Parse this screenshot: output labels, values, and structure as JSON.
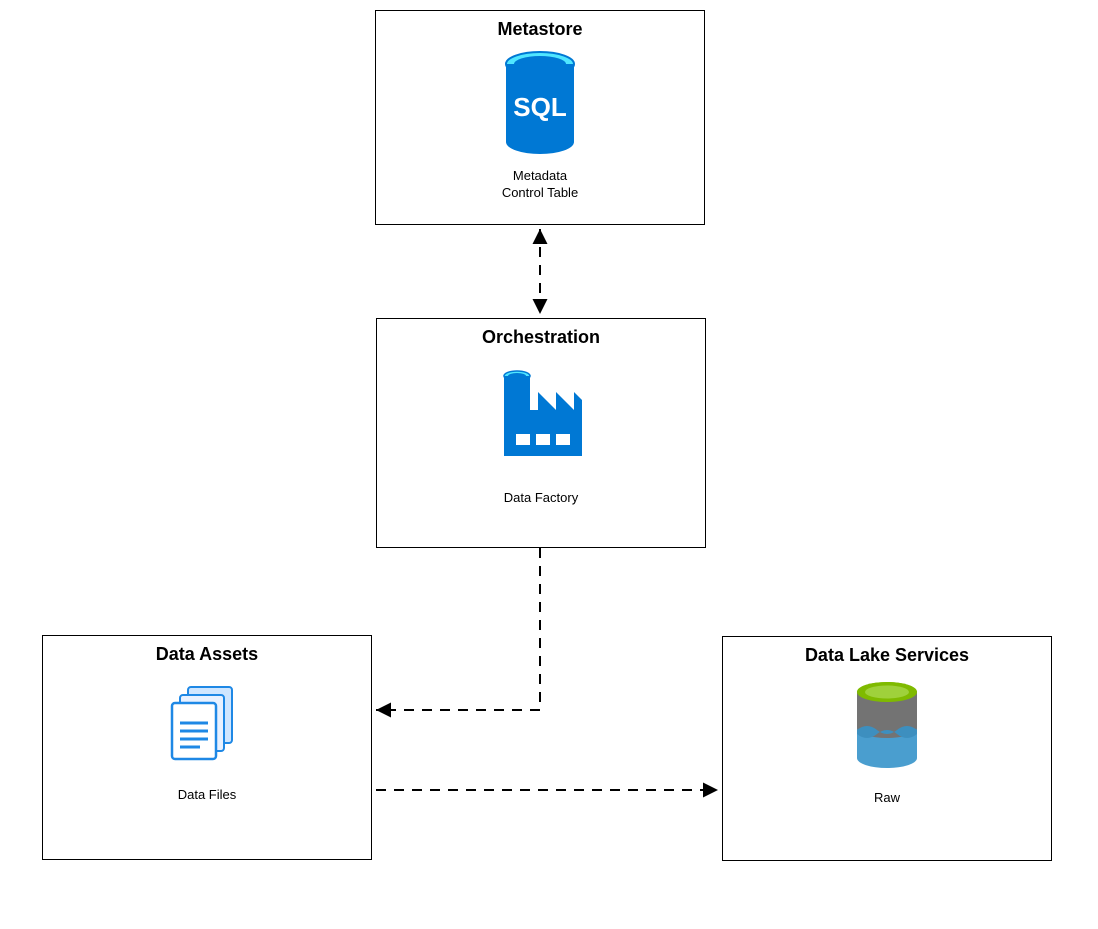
{
  "boxes": {
    "metastore": {
      "title": "Metastore",
      "caption_line1": "Metadata",
      "caption_line2": "Control Table"
    },
    "orchestration": {
      "title": "Orchestration",
      "caption_line1": "Data Factory"
    },
    "data_assets": {
      "title": "Data Assets",
      "caption_line1": "Data Files"
    },
    "data_lake": {
      "title": "Data Lake Services",
      "caption_line1": "Raw"
    }
  },
  "icons": {
    "sql": "sql-database-icon",
    "factory": "data-factory-icon",
    "files": "data-files-icon",
    "lake": "data-lake-icon"
  },
  "colors": {
    "azure_blue": "#0078d4",
    "azure_cyan": "#50e6ff",
    "lake_green": "#7fba00",
    "lake_grey": "#737373",
    "lake_blue": "#4a9ecf"
  }
}
